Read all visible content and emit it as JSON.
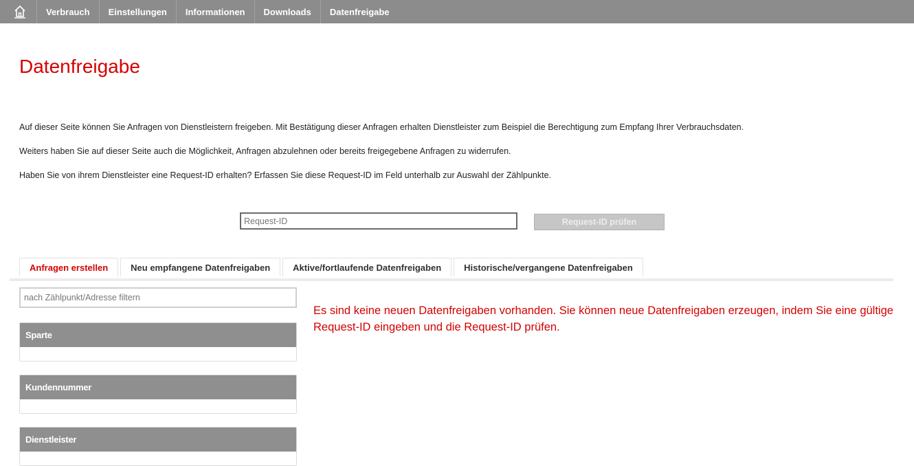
{
  "nav": {
    "home_icon": "home-icon",
    "items": [
      "Verbrauch",
      "Einstellungen",
      "Informationen",
      "Downloads",
      "Datenfreigabe"
    ]
  },
  "page": {
    "title": "Datenfreigabe",
    "paragraphs": [
      "Auf dieser Seite können Sie Anfragen von Dienstleistern freigeben. Mit Bestätigung dieser Anfragen erhalten Dienstleister zum Beispiel die Berechtigung zum Empfang Ihrer Verbrauchsdaten.",
      "Weiters haben Sie auf dieser Seite auch die Möglichkeit, Anfragen abzulehnen oder bereits freigegebene Anfragen zu widerrufen.",
      "Haben Sie von ihrem Dienstleister eine Request-ID erhalten? Erfassen Sie diese Request-ID im Feld unterhalb zur Auswahl der Zählpunkte."
    ]
  },
  "request": {
    "placeholder": "Request-ID",
    "value": "",
    "button_label": "Request-ID prüfen"
  },
  "tabs": [
    {
      "label": "Anfragen erstellen",
      "active": true
    },
    {
      "label": "Neu empfangene Datenfreigaben",
      "active": false
    },
    {
      "label": "Aktive/fortlaufende Datenfreigaben",
      "active": false
    },
    {
      "label": "Historische/vergangene Datenfreigaben",
      "active": false
    }
  ],
  "filter": {
    "placeholder": "nach Zählpunkt/Adresse filtern"
  },
  "panels": [
    {
      "label": "Sparte"
    },
    {
      "label": "Kundennummer"
    },
    {
      "label": "Dienstleister"
    }
  ],
  "message": "Es sind keine neuen Datenfreigaben vorhanden. Sie können neue Datenfreigaben erzeugen, indem Sie eine gültige Request-ID eingeben und die Request-ID prüfen.",
  "colors": {
    "accent": "#d40000",
    "nav_bg": "#8c8c8c",
    "panel_head": "#8f8f8f",
    "button_disabled": "#c6c6c6"
  }
}
